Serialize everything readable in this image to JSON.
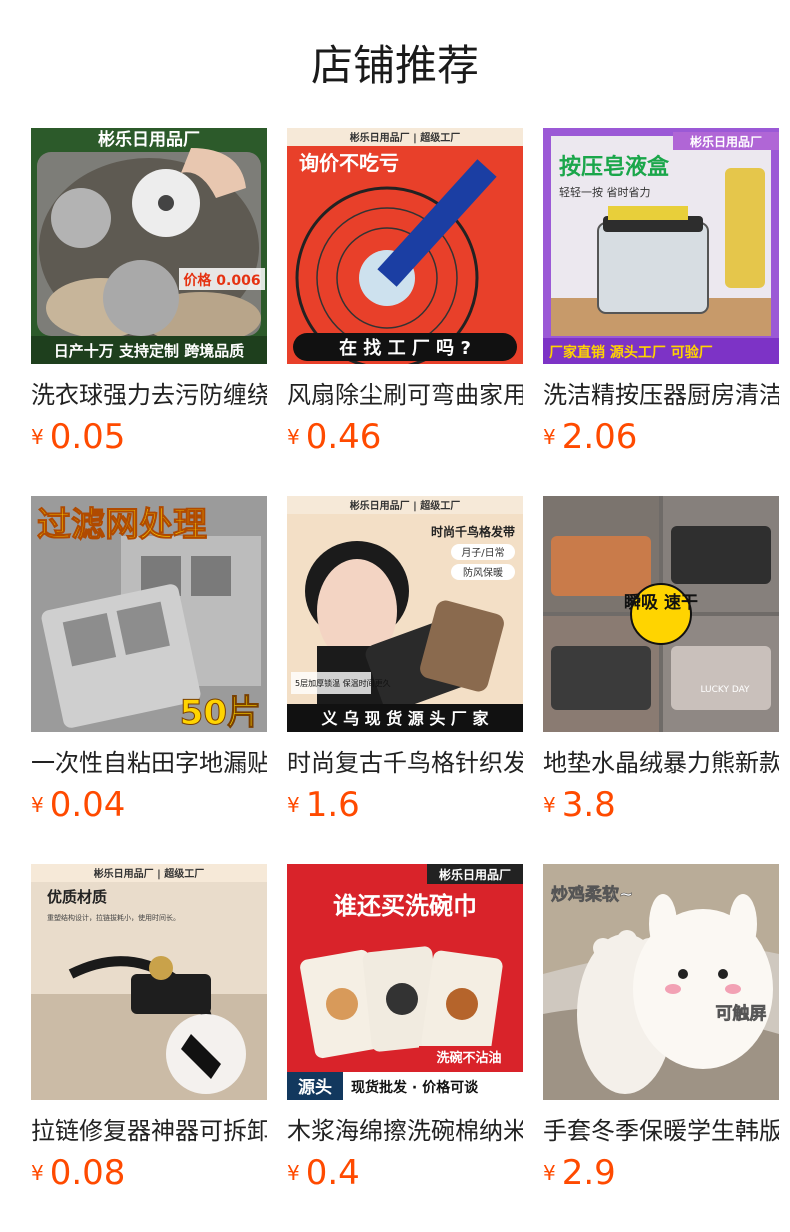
{
  "section_title": "店铺推荐",
  "currency_symbol": "¥",
  "accent_color": "#ff4a00",
  "products": [
    {
      "title": "洗衣球强力去污防缠绕",
      "price": "0.05",
      "image_text": {
        "top": "彬乐日用品厂",
        "mid": "价格 0.006",
        "bottom": "日产十万 支持定制 跨境品质"
      }
    },
    {
      "title": "风扇除尘刷可弯曲家用",
      "price": "0.46",
      "image_text": {
        "top": "彬乐日用品厂 | 超级工厂",
        "mid": "询价不吃亏",
        "bottom": "在 找 工 厂 吗 ?"
      }
    },
    {
      "title": "洗洁精按压器厨房清洁",
      "price": "2.06",
      "image_text": {
        "top": "彬乐日用品厂",
        "mid": "按压皂液盒",
        "sub": "轻轻一按 省时省力",
        "bottom": "厂家直销  源头工厂 可验厂"
      }
    },
    {
      "title": "一次性自粘田字地漏贴",
      "price": "0.04",
      "image_text": {
        "top": "过滤网处理",
        "bottom": "50片"
      }
    },
    {
      "title": "时尚复古千鸟格针织发带",
      "price": "1.6",
      "image_text": {
        "top": "彬乐日用品厂 | 超级工厂",
        "mid": "时尚千鸟格发带",
        "tag1": "月子/日常",
        "tag2": "防风保暖",
        "note": "5层加厚锁温 保温时间更久",
        "bottom": "义 乌 现 货 源 头 厂 家"
      }
    },
    {
      "title": "地垫水晶绒暴力熊新款",
      "price": "3.8",
      "image_text": {
        "mid": "瞬吸 速干",
        "mat": "LUCKY DAY"
      }
    },
    {
      "title": "拉链修复器神器可拆卸",
      "price": "0.08",
      "image_text": {
        "top": "彬乐日用品厂 | 超级工厂",
        "mid": "优质材质",
        "sub": "重塑结构设计，拉链拔耗小，使用时间长。"
      }
    },
    {
      "title": "木浆海绵擦洗碗棉纳米",
      "price": "0.4",
      "image_text": {
        "top": "彬乐日用品厂",
        "mid": "谁还买洗碗巾",
        "tag1": "洗碗不沾油",
        "bottom_a": "源头",
        "bottom_b": "现货批发 · 价格可谈"
      }
    },
    {
      "title": "手套冬季保暖学生韩版",
      "price": "2.9",
      "image_text": {
        "top": "炒鸡柔软~",
        "mid": "可触屏"
      }
    }
  ]
}
